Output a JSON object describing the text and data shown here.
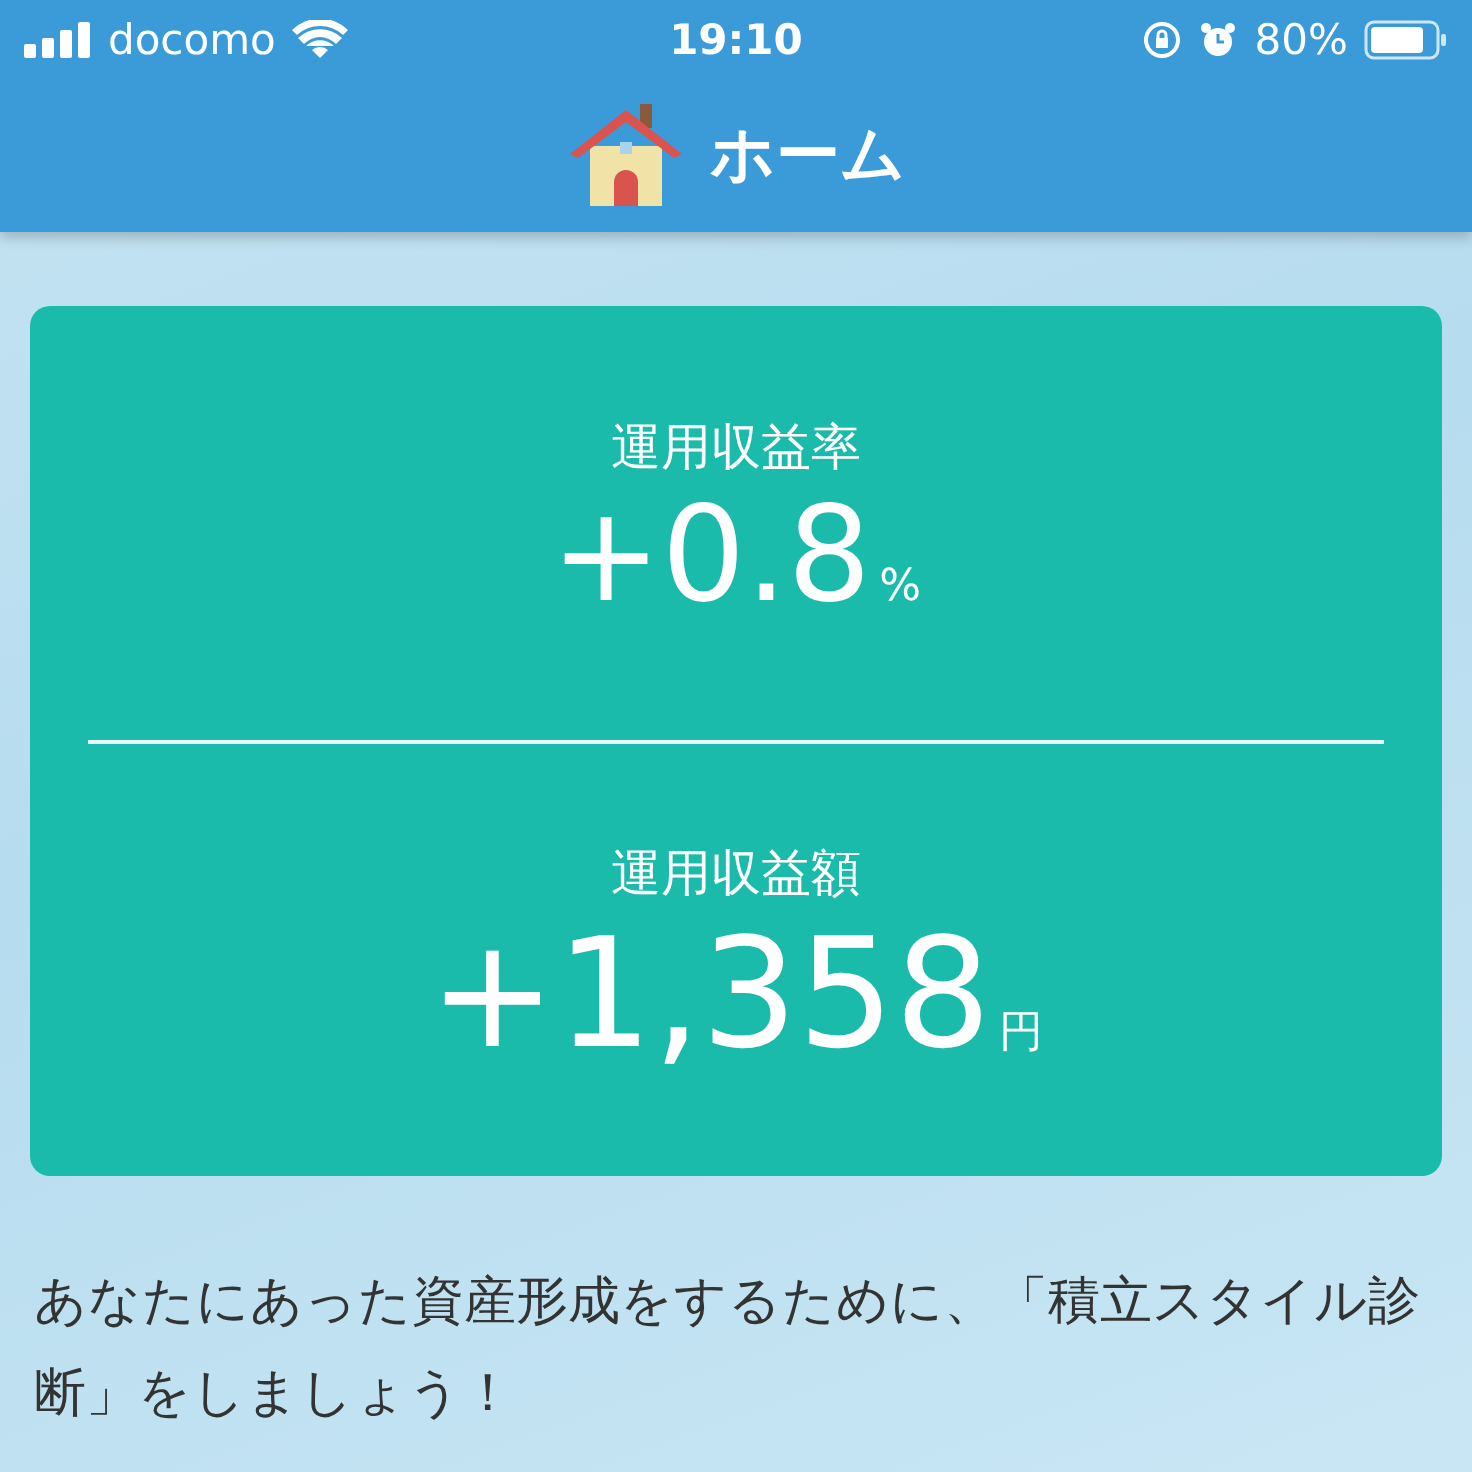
{
  "status_bar": {
    "carrier": "docomo",
    "time": "19:10",
    "battery": "80%"
  },
  "header": {
    "title": "ホーム"
  },
  "metrics": [
    {
      "label": "運用収益率",
      "value": "+0.8",
      "unit": "%"
    },
    {
      "label": "運用収益額",
      "value": "+1,358",
      "unit": "円"
    }
  ],
  "message": "あなたにあった資産形成をするために、「積立スタイル診断」をしましょう！"
}
